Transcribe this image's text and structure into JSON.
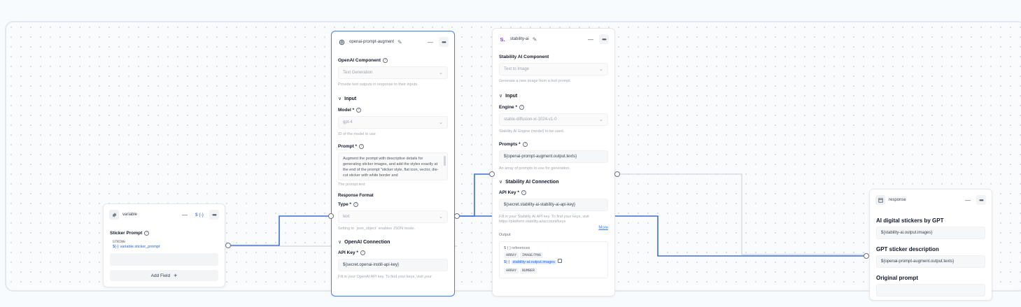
{
  "variable_node": {
    "title": "variable",
    "var_badge": "$ {-}",
    "field_label": "Sticker Prompt",
    "type": "STRING",
    "ref_prefix": "${-}",
    "ref": "variable.sticker_prompt",
    "add_field": "Add Field",
    "add_icon": "+"
  },
  "openai_node": {
    "title": "openai-prompt-augment",
    "component_label": "OpenAI Component",
    "component_value": "Text Generation",
    "component_hint": "Provide text outputs in response to their inputs.",
    "input_section": "Input",
    "model_label": "Model *",
    "model_value": "gpt-4",
    "model_hint": "ID of the model to use",
    "prompt_label": "Prompt *",
    "prompt_value": "Augment the prompt with descriptive details for generating sticker images, and add the styles exactly at the end of the prompt \"sticker style, flat icon, vector, die-cut sticker with white border and",
    "prompt_hint": "The prompt text",
    "response_format": "Response Format",
    "type_label": "Type *",
    "type_value": "text",
    "type_hint": "Setting to `json_object` enables JSON mode.",
    "connection_section": "OpenAI Connection",
    "api_key_label": "API Key *",
    "api_key_value": "${secret.openai-instill-api-key}",
    "api_key_hint": "Fill in your OpenAI API key. To find your keys, visit your"
  },
  "stability_node": {
    "title": "stability-ai",
    "icon_text": "S.",
    "component_label": "Stability AI Component",
    "component_value": "Text to Image",
    "component_hint": "Generate a new image from a text prompt.",
    "input_section": "Input",
    "engine_label": "Engine *",
    "engine_value": "stable-diffusion-xl-1024-v1-0",
    "engine_hint": "Stability AI Engine (model) to be used.",
    "prompts_label": "Prompts *",
    "prompts_value": "${openai-prompt-augment.output.texts}",
    "prompts_hint": "An array of prompts to use for generation.",
    "connection_section": "Stability AI Connection",
    "api_key_label": "API Key *",
    "api_key_value": "${secret.stability-ai-stability-ai-api-key}",
    "api_key_hint": "Fill in your Stability AI API key. To find your keys, visit https://platform.stability.ai/account/keys",
    "more_link": "More",
    "output_label": "Output",
    "references": "$ ( ) references",
    "array_tag": "ARRAY",
    "image_tag": "IMAGE/PNG",
    "images_ref_prefix": "${-}",
    "images_ref": "stability-ai.output.images",
    "number_tag": "NUMBER"
  },
  "response_node": {
    "title": "response",
    "items": [
      {
        "label": "AI digital stickers by GPT",
        "value": "${stability-ai.output.images}"
      },
      {
        "label": "GPT sticker description",
        "value": "${openai-prompt-augment.output.texts}"
      },
      {
        "label": "Original prompt",
        "value": ""
      }
    ]
  },
  "icons": {
    "minus": "—",
    "dots": "•••",
    "chevron_down": "⌄",
    "chevron_open": "∨",
    "pencil": "✎",
    "question": "?"
  }
}
